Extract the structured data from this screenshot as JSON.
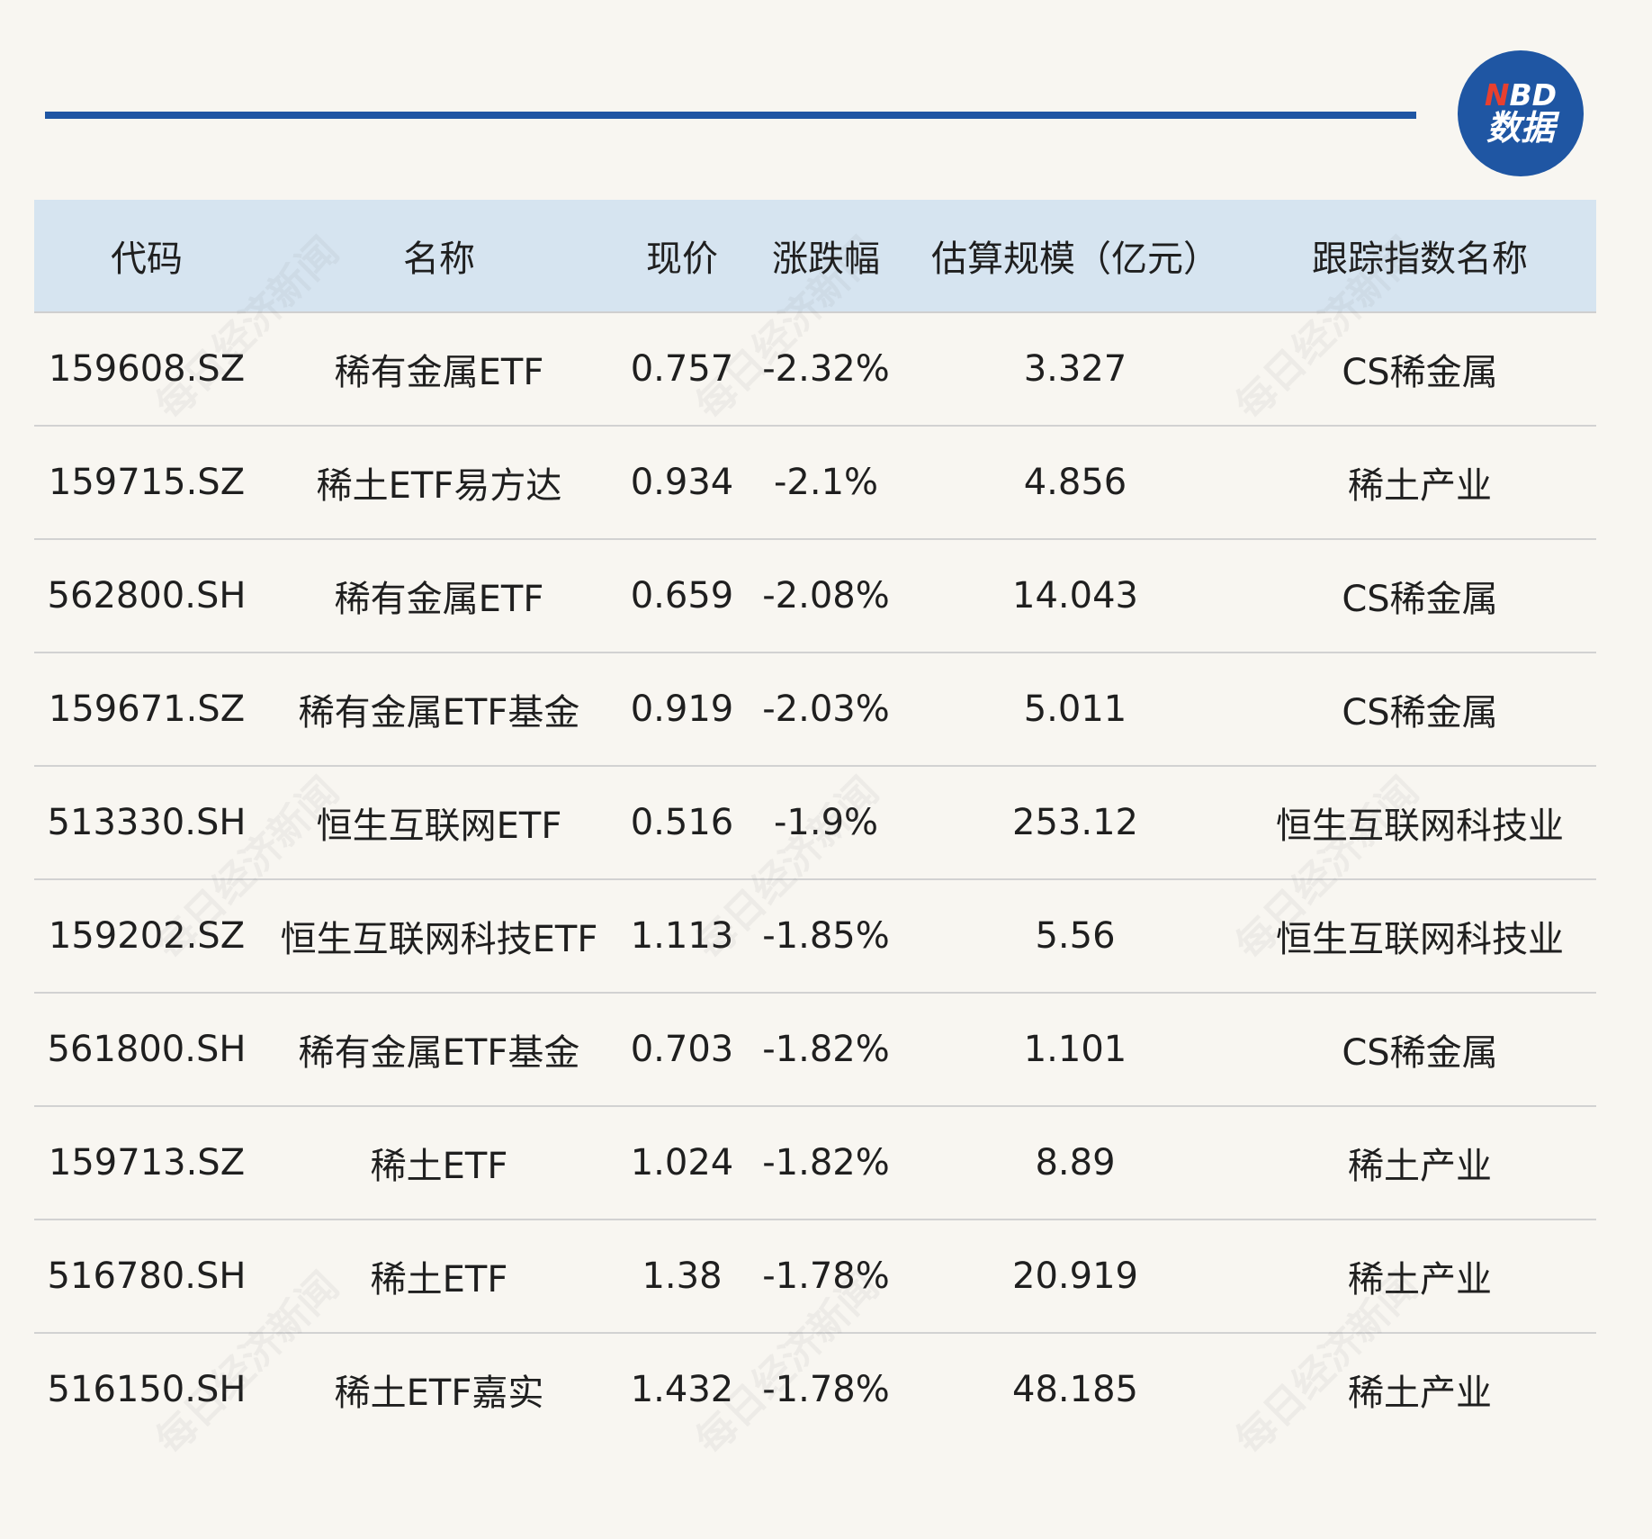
{
  "logo": {
    "brand_n": "N",
    "brand_rest": "BD",
    "sub": "数据"
  },
  "watermark_text": "每日经济新闻",
  "table": {
    "headers": [
      "代码",
      "名称",
      "现价",
      "涨跌幅",
      "估算规模（亿元）",
      "跟踪指数名称"
    ],
    "rows": [
      {
        "code": "159608.SZ",
        "name": "稀有金属ETF",
        "price": "0.757",
        "change": "-2.32%",
        "size": "3.327",
        "index": "CS稀金属"
      },
      {
        "code": "159715.SZ",
        "name": "稀土ETF易方达",
        "price": "0.934",
        "change": "-2.1%",
        "size": "4.856",
        "index": "稀土产业"
      },
      {
        "code": "562800.SH",
        "name": "稀有金属ETF",
        "price": "0.659",
        "change": "-2.08%",
        "size": "14.043",
        "index": "CS稀金属"
      },
      {
        "code": "159671.SZ",
        "name": "稀有金属ETF基金",
        "price": "0.919",
        "change": "-2.03%",
        "size": "5.011",
        "index": "CS稀金属"
      },
      {
        "code": "513330.SH",
        "name": "恒生互联网ETF",
        "price": "0.516",
        "change": "-1.9%",
        "size": "253.12",
        "index": "恒生互联网科技业"
      },
      {
        "code": "159202.SZ",
        "name": "恒生互联网科技ETF",
        "price": "1.113",
        "change": "-1.85%",
        "size": "5.56",
        "index": "恒生互联网科技业"
      },
      {
        "code": "561800.SH",
        "name": "稀有金属ETF基金",
        "price": "0.703",
        "change": "-1.82%",
        "size": "1.101",
        "index": "CS稀金属"
      },
      {
        "code": "159713.SZ",
        "name": "稀土ETF",
        "price": "1.024",
        "change": "-1.82%",
        "size": "8.89",
        "index": "稀土产业"
      },
      {
        "code": "516780.SH",
        "name": "稀土ETF",
        "price": "1.38",
        "change": "-1.78%",
        "size": "20.919",
        "index": "稀土产业"
      },
      {
        "code": "516150.SH",
        "name": "稀土ETF嘉实",
        "price": "1.432",
        "change": "-1.78%",
        "size": "48.185",
        "index": "稀土产业"
      }
    ]
  }
}
